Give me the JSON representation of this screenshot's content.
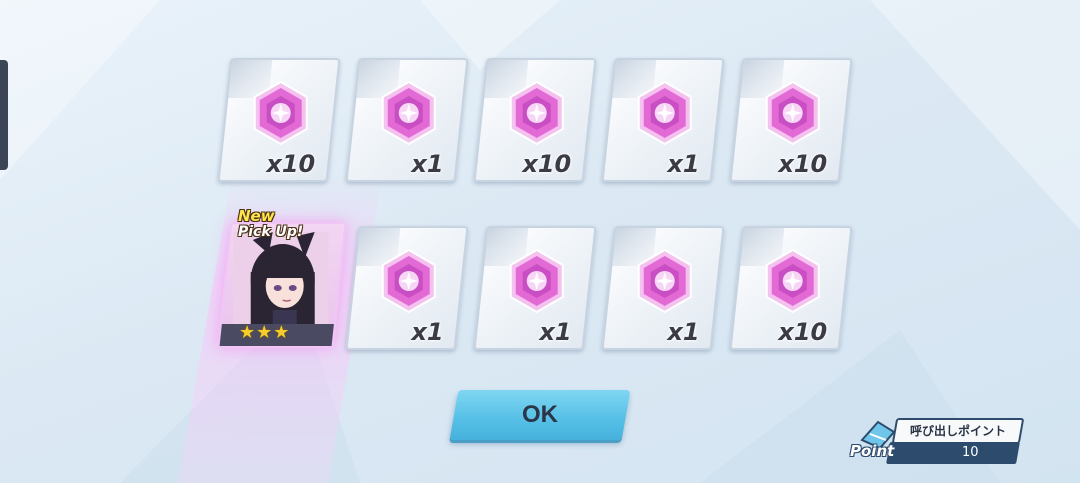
{
  "rewards_row1": [
    {
      "item": "crystal-gem",
      "quantity": "x10"
    },
    {
      "item": "crystal-gem",
      "quantity": "x1"
    },
    {
      "item": "crystal-gem",
      "quantity": "x10"
    },
    {
      "item": "crystal-gem",
      "quantity": "x1"
    },
    {
      "item": "crystal-gem",
      "quantity": "x10"
    }
  ],
  "featured": {
    "badge_new": "New",
    "badge_pickup": "Pick Up!",
    "stars": "★★★"
  },
  "rewards_row2": [
    {
      "item": "crystal-gem",
      "quantity": "x1"
    },
    {
      "item": "crystal-gem",
      "quantity": "x1"
    },
    {
      "item": "crystal-gem",
      "quantity": "x1"
    },
    {
      "item": "crystal-gem",
      "quantity": "x10"
    }
  ],
  "ok_button": {
    "label": "OK"
  },
  "point_panel": {
    "title": "呼び出しポイント",
    "value": "10",
    "icon_label": "Point"
  },
  "colors": {
    "gem": "#e66ad6",
    "ok_button": "#5ac3e8",
    "panel_dark": "#2d4c6d",
    "star": "#f5cc2b"
  }
}
